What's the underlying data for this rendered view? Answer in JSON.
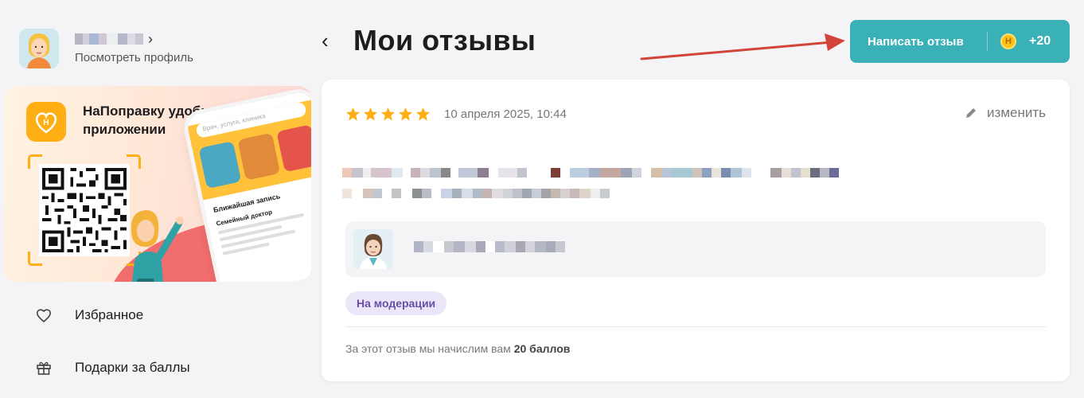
{
  "sidebar": {
    "view_profile": "Посмотреть профиль",
    "promo": {
      "title": "НаПоправку удобнее в приложении",
      "phone_search": "Врач, услуга, клиника",
      "phone_heading": "Ближайшая запись",
      "phone_sub": "Семейный доктор"
    },
    "menu": [
      {
        "label": "Избранное",
        "icon": "heart-icon"
      },
      {
        "label": "Подарки за баллы",
        "icon": "gift-icon"
      }
    ]
  },
  "header": {
    "title": "Мои отзывы",
    "write_button": "Написать отзыв",
    "coin_letter": "Н",
    "bonus": "+20"
  },
  "review": {
    "rating": 5,
    "date": "10 апреля 2025, 10:44",
    "edit_label": "изменить",
    "status": "На модерации",
    "note_prefix": "За этот отзыв мы начислим вам ",
    "note_points": "20 баллов"
  },
  "colors": {
    "accent": "#3ab0b7",
    "star": "#ffae14",
    "status_bg": "#ece7f8",
    "status_text": "#6a4fa8",
    "arrow": "#d2433a"
  }
}
